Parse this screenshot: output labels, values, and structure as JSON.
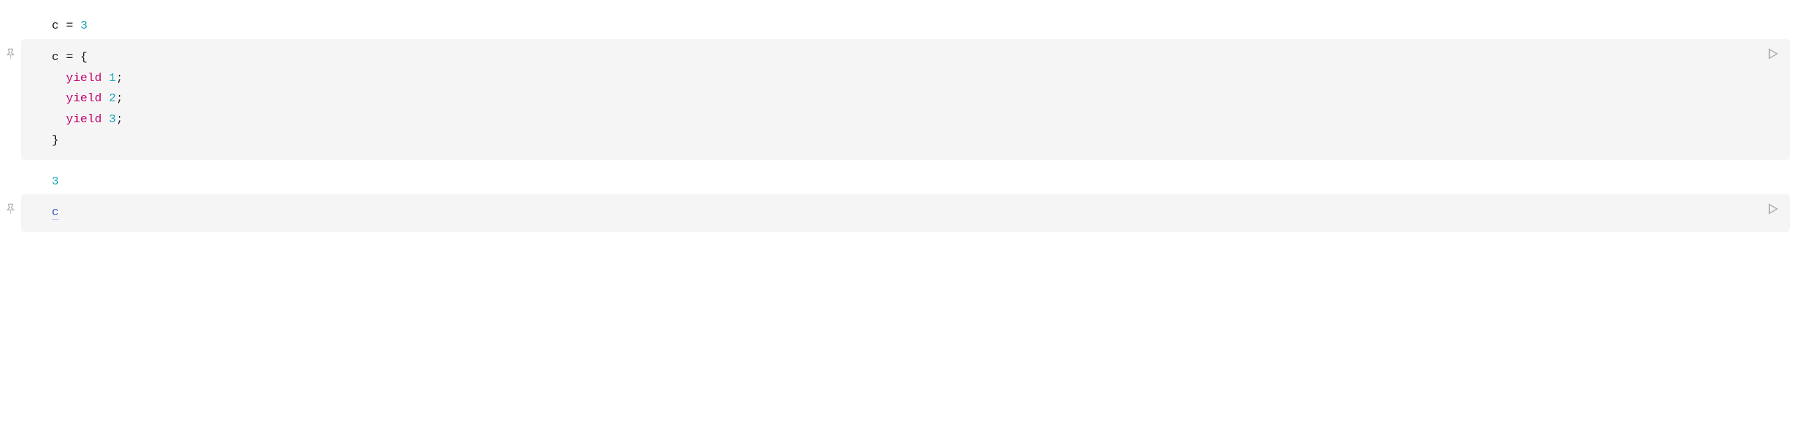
{
  "cells": [
    {
      "output": {
        "prefix_var": "c",
        "prefix_eq": " = ",
        "value": "3"
      },
      "code": {
        "line1_var": "c",
        "line1_rest": " = {",
        "line2_indent": "  ",
        "line2_kw": "yield",
        "line2_rest": " ",
        "line2_num": "1",
        "line2_semi": ";",
        "line3_indent": "  ",
        "line3_kw": "yield",
        "line3_rest": " ",
        "line3_num": "2",
        "line3_semi": ";",
        "line4_indent": "  ",
        "line4_kw": "yield",
        "line4_rest": " ",
        "line4_num": "3",
        "line4_semi": ";",
        "line5": "}"
      }
    },
    {
      "output": {
        "value": "3"
      },
      "code": {
        "line1": "c"
      }
    }
  ]
}
